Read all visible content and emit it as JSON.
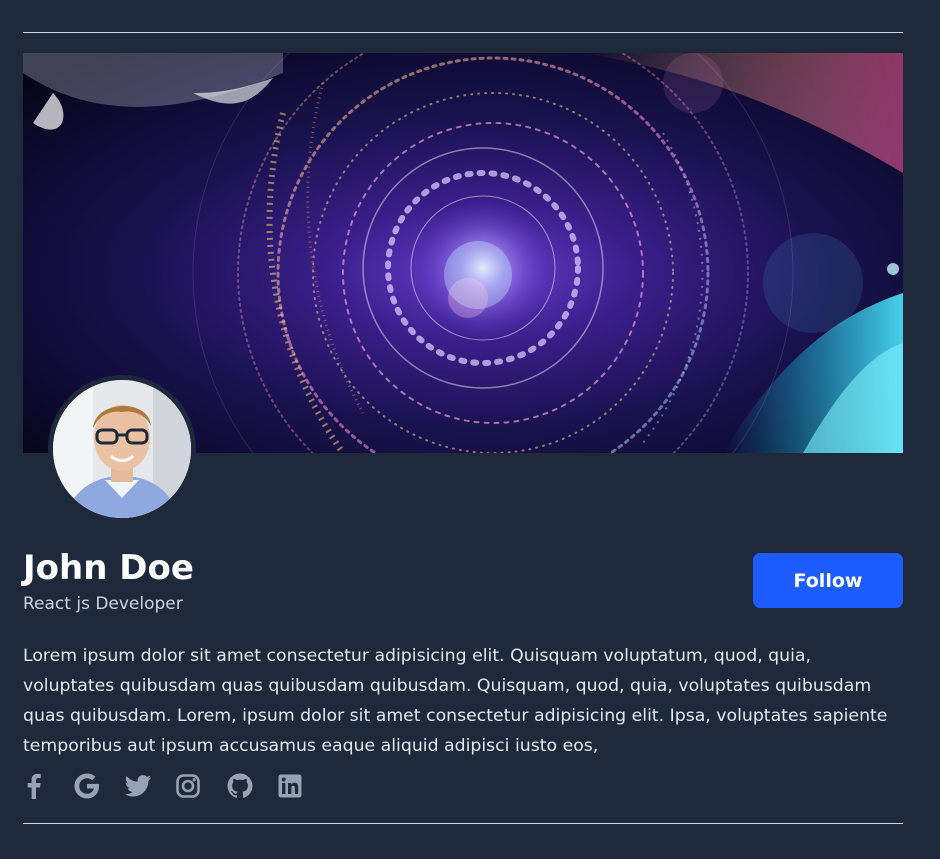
{
  "profile": {
    "name": "John Doe",
    "role": "React js Developer",
    "bio": "Lorem ipsum dolor sit amet consectetur adipisicing elit. Quisquam voluptatum, quod, quia, voluptates quibusdam quas quibusdam quibusdam. Quisquam, quod, quia, voluptates quibusdam quas quibusdam. Lorem, ipsum dolor sit amet consectetur adipisicing elit. Ipsa, voluptates sapiente temporibus aut ipsum accusamus eaque aliquid adipisci iusto eos,"
  },
  "actions": {
    "follow_label": "Follow"
  },
  "socials": [
    {
      "icon": "facebook-icon"
    },
    {
      "icon": "google-icon"
    },
    {
      "icon": "twitter-icon"
    },
    {
      "icon": "instagram-icon"
    },
    {
      "icon": "github-icon"
    },
    {
      "icon": "linkedin-icon"
    }
  ],
  "colors": {
    "background": "#1e293b",
    "accent": "#1d5cff",
    "icon": "#94a3b8"
  }
}
